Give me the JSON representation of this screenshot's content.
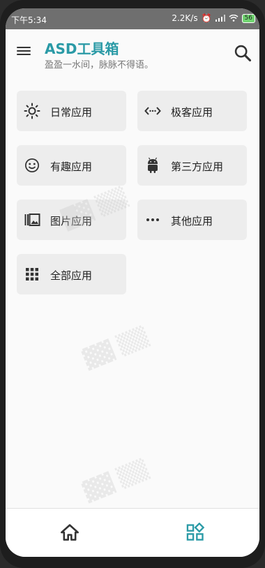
{
  "status_bar": {
    "time": "下午5:34",
    "speed": "2.2K/s",
    "battery": "56"
  },
  "header": {
    "title": "ASD工具箱",
    "subtitle": "盈盈一水间，脉脉不得语。"
  },
  "tiles": [
    {
      "label": "日常应用",
      "icon": "sun-icon"
    },
    {
      "label": "极客应用",
      "icon": "code-icon"
    },
    {
      "label": "有趣应用",
      "icon": "smiley-icon"
    },
    {
      "label": "第三方应用",
      "icon": "android-icon"
    },
    {
      "label": "图片应用",
      "icon": "photo-library-icon"
    },
    {
      "label": "其他应用",
      "icon": "more-dots-icon"
    },
    {
      "label": "全部应用",
      "icon": "apps-grid-icon"
    }
  ],
  "colors": {
    "accent": "#2a9aa6",
    "tile_bg": "#ededed"
  }
}
